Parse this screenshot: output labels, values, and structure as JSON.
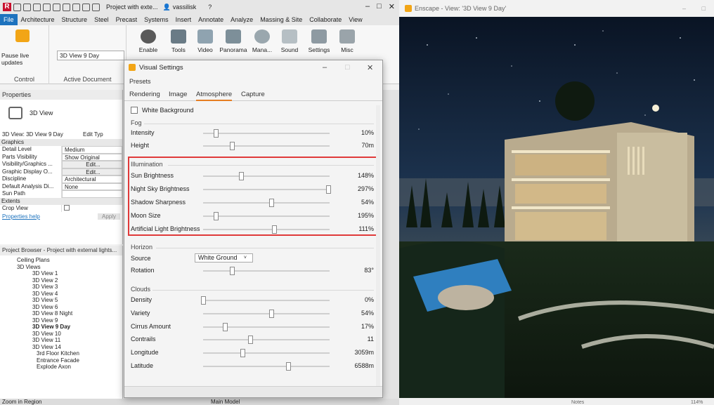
{
  "revit": {
    "qat_title": "Project with exte...",
    "user": "vassilisk",
    "tabs": [
      "File",
      "Architecture",
      "Structure",
      "Steel",
      "Precast",
      "Systems",
      "Insert",
      "Annotate",
      "Analyze",
      "Massing & Site",
      "Collaborate",
      "View"
    ],
    "pause_label": "Pause live updates",
    "active_doc_value": "3D View 9 Day",
    "panel_control": "Control",
    "panel_active_doc": "Active Document",
    "ribbon_buttons": [
      "Enable",
      "Tools",
      "Video",
      "Panorama",
      "Mana...",
      "Sound",
      "Settings",
      "Misc"
    ],
    "properties_title": "Properties",
    "view_type": "3D View",
    "view_selector": "3D View: 3D View 9 Day",
    "edit_type": "Edit Typ",
    "groups": {
      "graphics": "Graphics",
      "extents": "Extents"
    },
    "prop_rows": [
      {
        "k": "Detail Level",
        "v": "Medium"
      },
      {
        "k": "Parts Visibility",
        "v": "Show Original"
      },
      {
        "k": "Visibility/Graphics ...",
        "v": "Edit..."
      },
      {
        "k": "Graphic Display O...",
        "v": "Edit..."
      },
      {
        "k": "Discipline",
        "v": "Architectural"
      },
      {
        "k": "Default Analysis Di...",
        "v": "None"
      },
      {
        "k": "Sun Path",
        "v": ""
      }
    ],
    "crop_view": "Crop View",
    "properties_help": "Properties help",
    "apply": "Apply",
    "browser_title": "Project Browser - Project with external lights...",
    "browser_items": [
      "Ceiling Plans",
      "3D Views",
      "3D View 1",
      "3D View 2",
      "3D View 3",
      "3D View 4",
      "3D View 5",
      "3D View 6",
      "3D View 8 Night",
      "3D View 9",
      "3D View 9 Day",
      "3D View 10",
      "3D View 11",
      "3D View 14",
      "3rd Floor Kitchen",
      "Entrance Facade",
      "Explode Axon"
    ],
    "status_left": "Zoom in Region",
    "status_model": "Main Model"
  },
  "dialog": {
    "title": "Visual Settings",
    "presets": "Presets",
    "tabs": [
      "Rendering",
      "Image",
      "Atmosphere",
      "Capture"
    ],
    "active_tab": "Atmosphere",
    "white_background": "White Background",
    "fog": {
      "title": "Fog",
      "rows": [
        {
          "label": "Intensity",
          "value": "10%",
          "pos": 0.1
        },
        {
          "label": "Height",
          "value": "70m",
          "pos": 0.23
        }
      ]
    },
    "illumination": {
      "title": "Illumination",
      "rows": [
        {
          "label": "Sun Brightness",
          "value": "148%",
          "pos": 0.3
        },
        {
          "label": "Night Sky Brightness",
          "value": "297%",
          "pos": 0.99
        },
        {
          "label": "Shadow Sharpness",
          "value": "54%",
          "pos": 0.54
        },
        {
          "label": "Moon Size",
          "value": "195%",
          "pos": 0.1
        },
        {
          "label": "Artificial Light Brightness",
          "value": "111%",
          "pos": 0.56
        }
      ]
    },
    "horizon": {
      "title": "Horizon",
      "source_label": "Source",
      "source_value": "White Ground",
      "rows": [
        {
          "label": "Rotation",
          "value": "83°",
          "pos": 0.23
        }
      ]
    },
    "clouds": {
      "title": "Clouds",
      "rows": [
        {
          "label": "Density",
          "value": "0%",
          "pos": 0.0
        },
        {
          "label": "Variety",
          "value": "54%",
          "pos": 0.54
        },
        {
          "label": "Cirrus Amount",
          "value": "17%",
          "pos": 0.17
        },
        {
          "label": "Contrails",
          "value": "11",
          "pos": 0.37
        },
        {
          "label": "Longitude",
          "value": "3059m",
          "pos": 0.31
        },
        {
          "label": "Latitude",
          "value": "6588m",
          "pos": 0.67
        }
      ]
    }
  },
  "enscape": {
    "title": "Enscape - View: '3D View 9 Day'",
    "status_notes": "Notes",
    "zoom": "114%"
  }
}
